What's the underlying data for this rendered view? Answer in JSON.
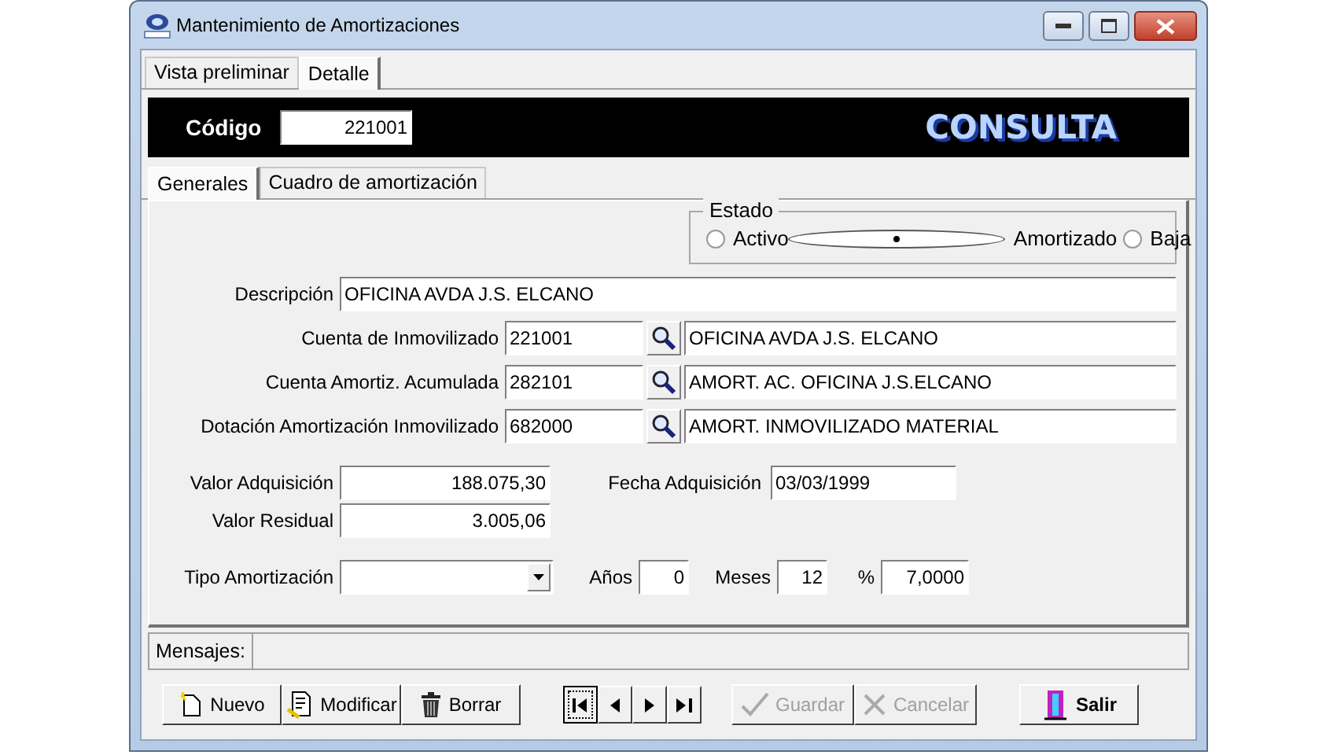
{
  "window": {
    "title": "Mantenimiento de Amortizaciones"
  },
  "tabs": [
    {
      "label": "Vista preliminar",
      "selected": false
    },
    {
      "label": "Detalle",
      "selected": true
    }
  ],
  "header": {
    "code_label": "Código",
    "code_value": "221001",
    "mode": "CONSULTA"
  },
  "subtabs": [
    {
      "label": "Generales",
      "selected": true
    },
    {
      "label": "Cuadro de amortización",
      "selected": false
    }
  ],
  "estado": {
    "legend": "Estado",
    "options": [
      {
        "label": "Activo",
        "selected": false
      },
      {
        "label": "Amortizado",
        "selected": true
      },
      {
        "label": "Baja",
        "selected": false
      }
    ]
  },
  "descripcion": {
    "label": "Descripción",
    "value": "OFICINA AVDA J.S. ELCANO"
  },
  "accounts": [
    {
      "label": "Cuenta de Inmovilizado",
      "code": "221001",
      "name": "OFICINA AVDA J.S. ELCANO"
    },
    {
      "label": "Cuenta Amortiz. Acumulada",
      "code": "282101",
      "name": "AMORT. AC. OFICINA J.S.ELCANO"
    },
    {
      "label": "Dotación Amortización Inmovilizado",
      "code": "682000",
      "name": "AMORT. INMOVILIZADO MATERIAL"
    }
  ],
  "valor_adquisicion": {
    "label": "Valor Adquisición",
    "value": "188.075,30"
  },
  "fecha_adquisicion": {
    "label": "Fecha Adquisición",
    "value": "03/03/1999"
  },
  "valor_residual": {
    "label": "Valor Residual",
    "value": "3.005,06"
  },
  "tipo_amortizacion": {
    "label": "Tipo Amortización"
  },
  "anos": {
    "label": "Años",
    "value": "0"
  },
  "meses": {
    "label": "Meses",
    "value": "12"
  },
  "porcentaje": {
    "label": "%",
    "value": "7,0000"
  },
  "mensajes": {
    "label": "Mensajes:"
  },
  "buttons": [
    {
      "label": "Nuevo",
      "disabled": false
    },
    {
      "label": "Modificar",
      "disabled": false
    },
    {
      "label": "Borrar",
      "disabled": false
    }
  ],
  "nav_buttons": [
    {
      "kind": "first"
    },
    {
      "kind": "prev"
    },
    {
      "kind": "next"
    },
    {
      "kind": "last"
    }
  ],
  "edit_buttons": [
    {
      "label": "Guardar",
      "disabled": true
    },
    {
      "label": "Cancelar",
      "disabled": true
    }
  ],
  "exit_button": {
    "label": "Salir",
    "disabled": false
  }
}
